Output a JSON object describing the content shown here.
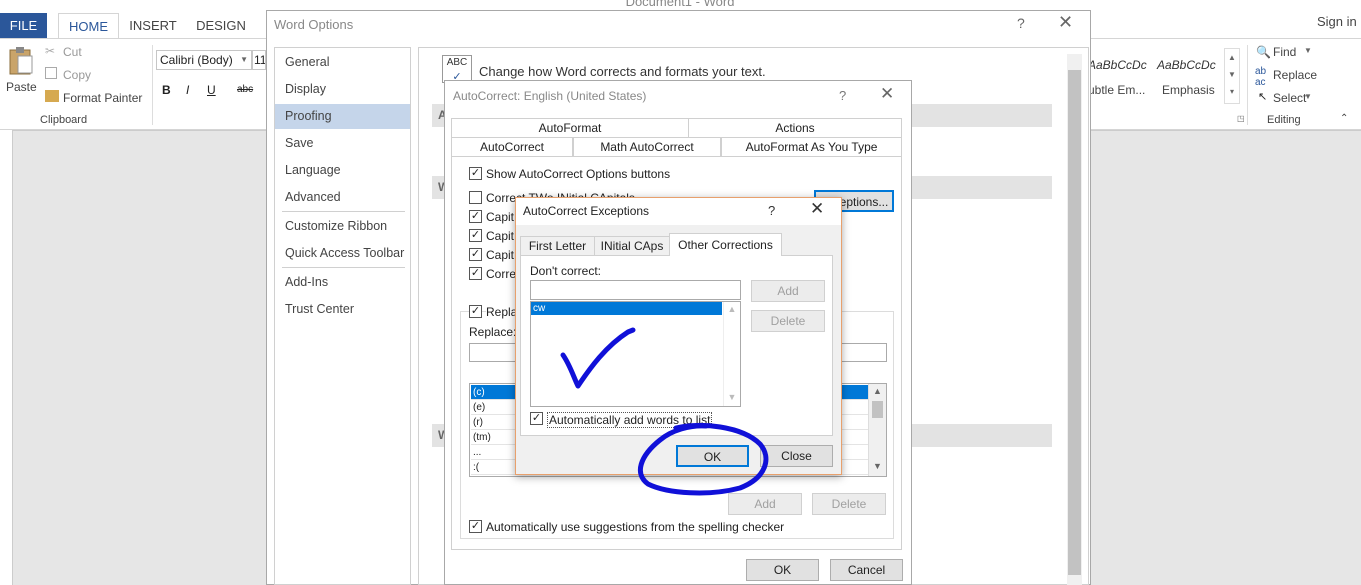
{
  "word": {
    "title": "Document1 - Word",
    "tabs": {
      "file": "FILE",
      "home": "HOME",
      "insert": "INSERT",
      "design": "DESIGN"
    },
    "sign_in": "Sign in",
    "clipboard": {
      "paste": "Paste",
      "cut": "Cut",
      "copy": "Copy",
      "format_painter": "Format Painter",
      "group_label": "Clipboard"
    },
    "font": {
      "name": "Calibri (Body)",
      "size": "11",
      "bold": "B",
      "italic": "I",
      "underline": "U",
      "strike": "abc"
    },
    "styles": {
      "style1_sample": "AaBbCcDc",
      "style1_name": "ubtle Em...",
      "style2_sample": "AaBbCcDc",
      "style2_name": "Emphasis"
    },
    "editing": {
      "find": "Find",
      "replace": "Replace",
      "select": "Select",
      "group_label": "Editing"
    }
  },
  "word_options": {
    "title": "Word Options",
    "help": "?",
    "close": "✕",
    "nav": [
      "General",
      "Display",
      "Proofing",
      "Save",
      "Language",
      "Advanced",
      "Customize Ribbon",
      "Quick Access Toolbar",
      "Add-Ins",
      "Trust Center"
    ],
    "selected_nav": "Proofing",
    "heading": "Change how Word corrects and formats your text.",
    "abc_icon_text": "ABC",
    "section_letters": [
      "A",
      "W",
      "W"
    ]
  },
  "autocorrect": {
    "title": "AutoCorrect: English (United States)",
    "help": "?",
    "close": "✕",
    "tabs_row1": [
      "AutoFormat",
      "Actions"
    ],
    "tabs_row2": [
      "AutoCorrect",
      "Math AutoCorrect",
      "AutoFormat As You Type"
    ],
    "active_tab": "AutoCorrect",
    "show_buttons": "Show AutoCorrect Options buttons",
    "options": [
      "Correct TWo INitial CApitals",
      "Capit",
      "Capit",
      "Capit",
      "Corre"
    ],
    "exceptions_button": "Exceptions...",
    "replace_checkbox": "Repla",
    "replace_label": "Replace:",
    "list": [
      "(c)",
      "(e)",
      "(r)",
      "(tm)",
      "...",
      ":("
    ],
    "add": "Add",
    "delete": "Delete",
    "auto_suggest": "Automatically use suggestions from the spelling checker",
    "ok": "OK",
    "cancel": "Cancel"
  },
  "exceptions": {
    "title": "AutoCorrect Exceptions",
    "help": "?",
    "close": "✕",
    "tabs": [
      "First Letter",
      "INitial CAps",
      "Other Corrections"
    ],
    "active_tab": "Other Corrections",
    "dont_correct_label": "Don't correct:",
    "input_value": "",
    "list": [
      "cw"
    ],
    "add": "Add",
    "delete": "Delete",
    "auto_add": "Automatically add words to list",
    "ok": "OK",
    "close_button": "Close"
  },
  "colors": {
    "accent": "#2b579a",
    "selection": "#0078d7",
    "annotation": "#1010d8"
  }
}
